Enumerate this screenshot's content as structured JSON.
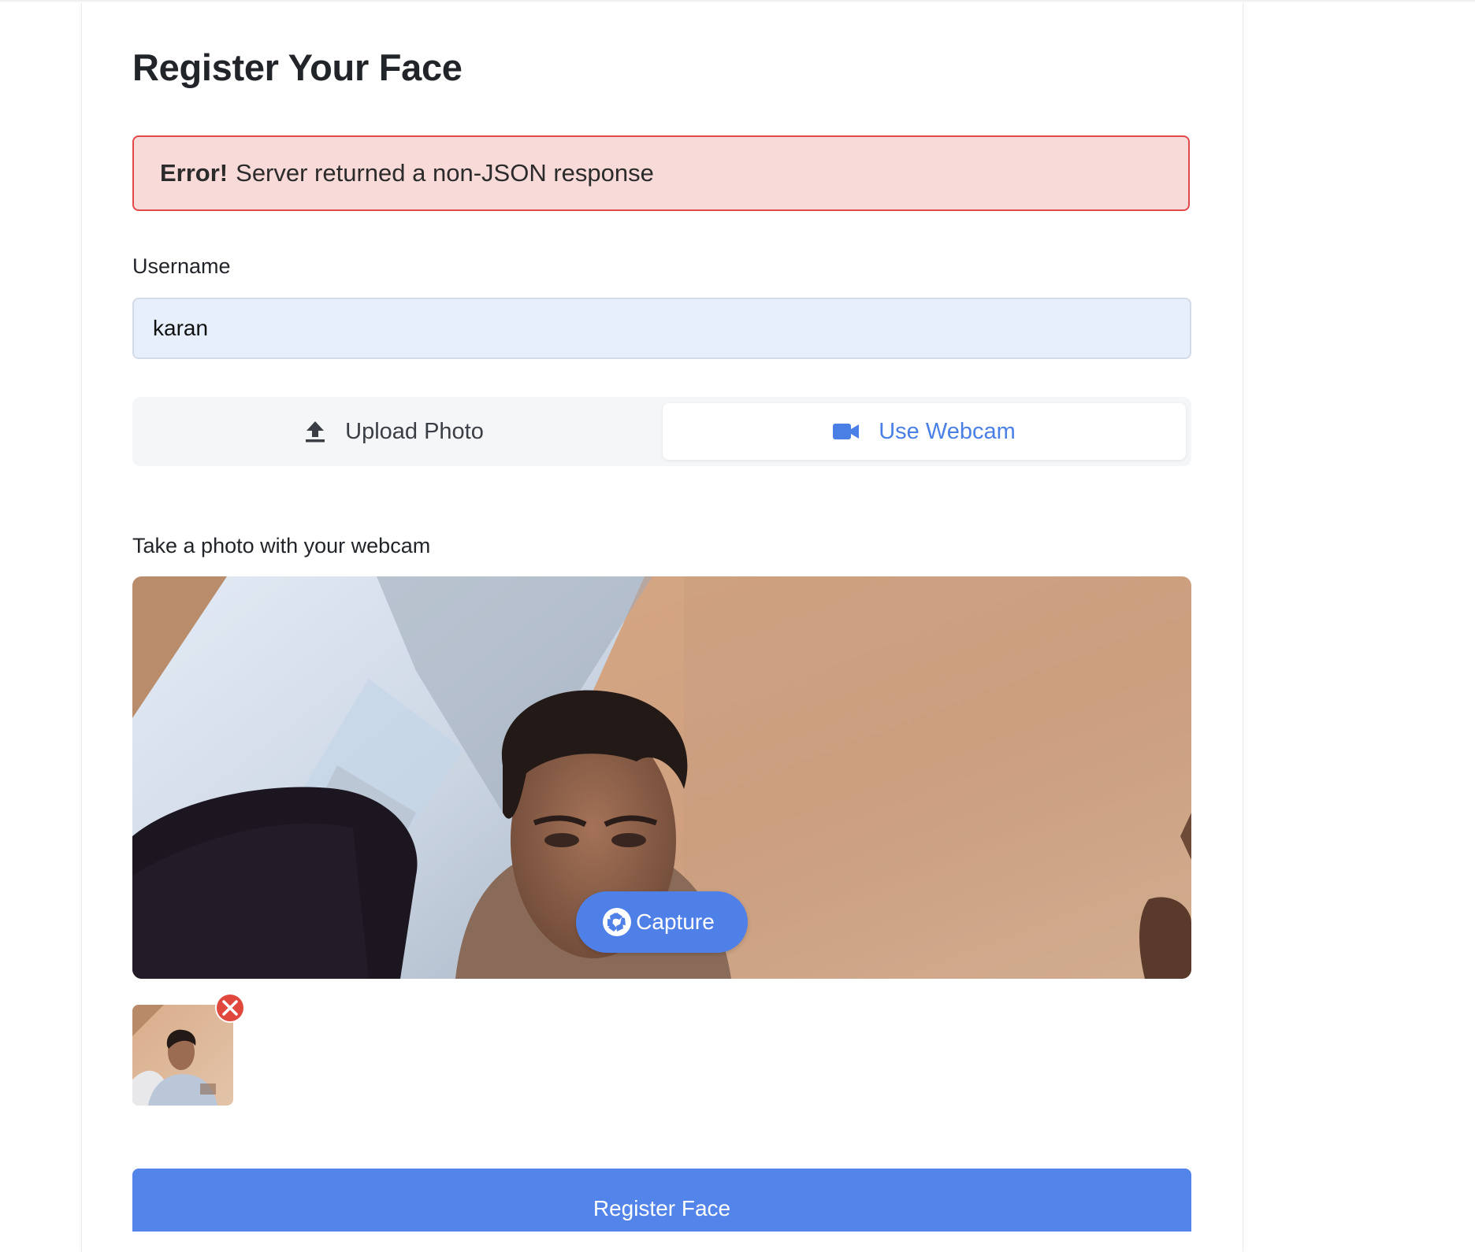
{
  "page": {
    "title": "Register Your Face"
  },
  "alert": {
    "prefix": "Error!",
    "message": "Server returned a non-JSON response"
  },
  "form": {
    "username_label": "Username",
    "username_value": "karan"
  },
  "tabs": [
    {
      "label": "Upload Photo",
      "icon": "upload-icon",
      "active": false
    },
    {
      "label": "Use Webcam",
      "icon": "video-camera-icon",
      "active": true
    }
  ],
  "webcam": {
    "label": "Take a photo with your webcam",
    "capture_label": "Capture",
    "capture_icon": "camera-shutter-icon"
  },
  "captured": {
    "remove_icon": "remove-circle-icon"
  },
  "submit": {
    "label": "Register Face"
  },
  "colors": {
    "primary": "#4f80e8",
    "alert_bg": "#f8dbd9",
    "alert_border": "#e0484a",
    "input_bg": "#e8effc",
    "active_tab_text": "#4a7fe6",
    "remove_red": "#e0483e"
  }
}
